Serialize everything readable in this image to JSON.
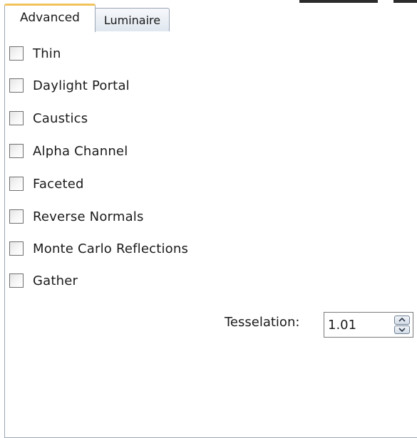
{
  "tabs": [
    {
      "label": "Advanced",
      "active": true
    },
    {
      "label": "Luminaire",
      "active": false
    }
  ],
  "checkboxes": [
    {
      "label": "Thin",
      "checked": false
    },
    {
      "label": "Daylight Portal",
      "checked": false
    },
    {
      "label": "Caustics",
      "checked": false
    },
    {
      "label": "Alpha Channel",
      "checked": false
    },
    {
      "label": "Faceted",
      "checked": false
    },
    {
      "label": "Reverse Normals",
      "checked": false
    },
    {
      "label": "Monte Carlo Reflections",
      "checked": false
    },
    {
      "label": "Gather",
      "checked": false
    }
  ],
  "tesselation": {
    "label": "Tesselation:",
    "value": "1.01"
  },
  "colors": {
    "active_tab_accent": "#f2c35c",
    "border": "#9aa6b5"
  }
}
